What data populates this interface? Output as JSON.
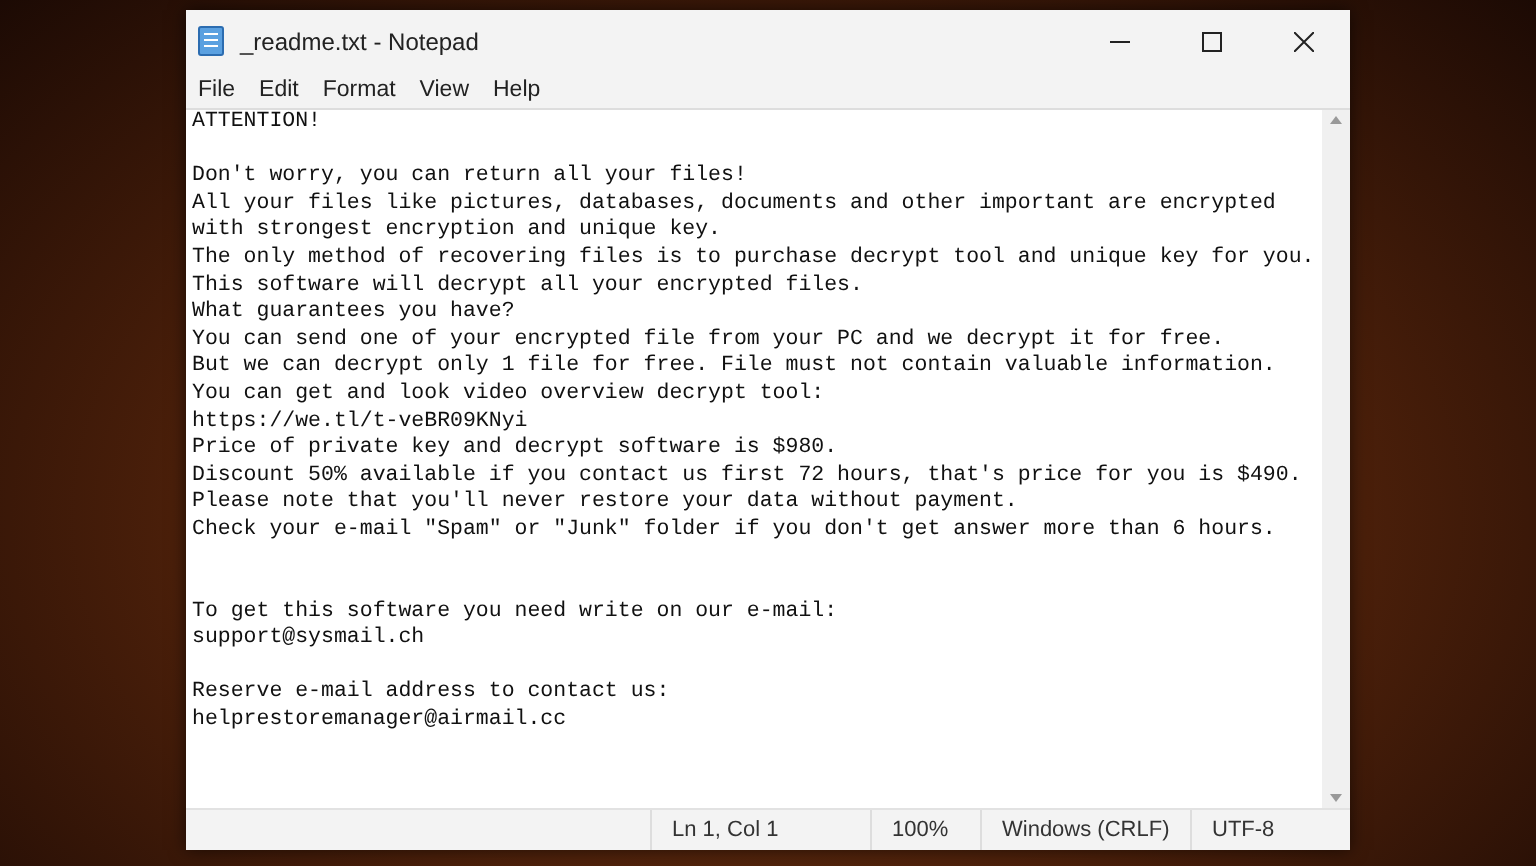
{
  "window": {
    "title": "_readme.txt - Notepad"
  },
  "menu": [
    "File",
    "Edit",
    "Format",
    "View",
    "Help"
  ],
  "document_lines": [
    {
      "kind": "text",
      "text": "ATTENTION!"
    },
    {
      "kind": "blank"
    },
    {
      "kind": "text",
      "text": "Don't worry, you can return all your files!"
    },
    {
      "kind": "text",
      "text": "All your files like pictures, databases, documents and other important are encrypted"
    },
    {
      "kind": "text",
      "text": "with strongest encryption and unique key."
    },
    {
      "kind": "text",
      "text": "The only method of recovering files is to purchase decrypt tool and unique key for you."
    },
    {
      "kind": "text",
      "text": "This software will decrypt all your encrypted files."
    },
    {
      "kind": "text",
      "text": "What guarantees you have?"
    },
    {
      "kind": "text",
      "text": "You can send one of your encrypted file from your PC and we decrypt it for free."
    },
    {
      "kind": "text",
      "text": "But we can decrypt only 1 file for free. File must not contain valuable information."
    },
    {
      "kind": "text",
      "text": "You can get and look video overview decrypt tool:"
    },
    {
      "kind": "text",
      "text": "https://we.tl/t-veBR09KNyi"
    },
    {
      "kind": "text",
      "text": "Price of private key and decrypt software is $980."
    },
    {
      "kind": "text",
      "text": "Discount 50% available if you contact us first 72 hours, that's price for you is $490."
    },
    {
      "kind": "text",
      "text": "Please note that you'll never restore your data without payment."
    },
    {
      "kind": "text",
      "text": "Check your e-mail \"Spam\" or \"Junk\" folder if you don't get answer more than 6 hours."
    },
    {
      "kind": "blank"
    },
    {
      "kind": "blank"
    },
    {
      "kind": "text",
      "text": "To get this software you need write on our e-mail:"
    },
    {
      "kind": "text",
      "text": "support@sysmail.ch"
    },
    {
      "kind": "blank"
    },
    {
      "kind": "text",
      "text": "Reserve e-mail address to contact us:"
    },
    {
      "kind": "text",
      "text": "helprestoremanager@airmail.cc"
    }
  ],
  "status_bar": [
    "Ln 1, Col 1",
    "100%",
    "Windows (CRLF)",
    "UTF-8"
  ]
}
